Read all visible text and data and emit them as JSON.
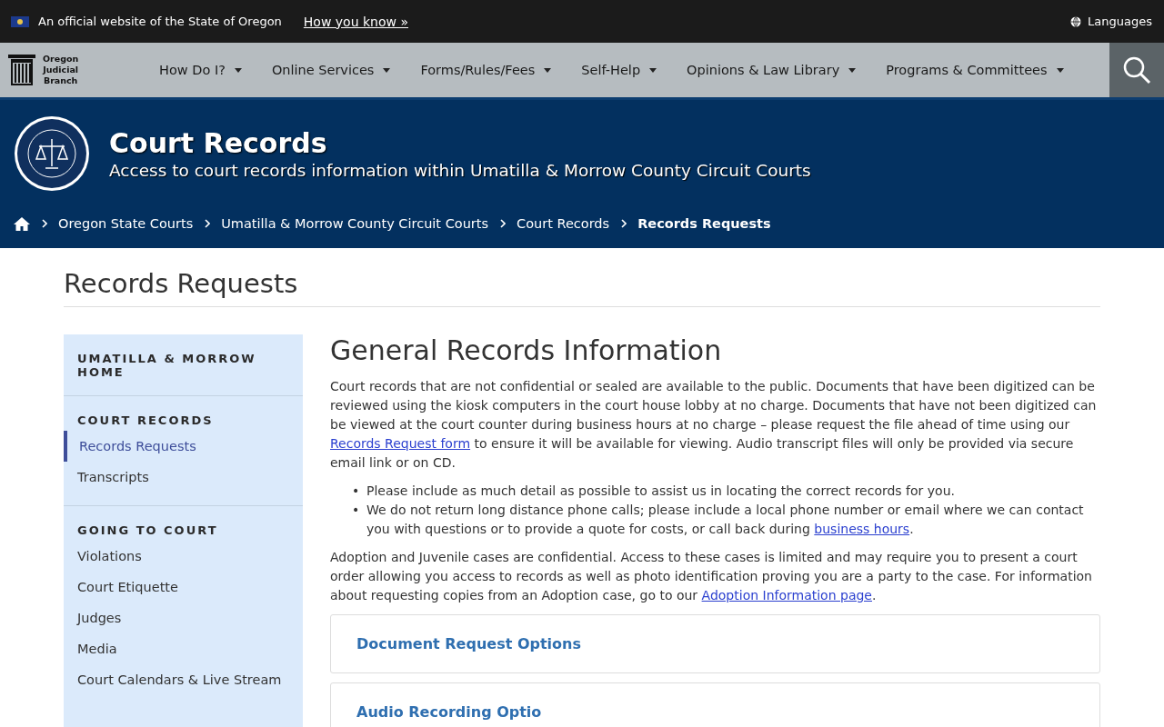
{
  "official_banner": {
    "text": "An official website of the State of Oregon",
    "link": "How you know »",
    "languages": "Languages"
  },
  "nav": {
    "logo": [
      "Oregon",
      "Judicial",
      "Branch"
    ],
    "items": [
      {
        "label": "How Do I?"
      },
      {
        "label": "Online Services"
      },
      {
        "label": "Forms/Rules/Fees"
      },
      {
        "label": "Self-Help"
      },
      {
        "label": "Opinions & Law Library"
      },
      {
        "label": "Programs & Committees"
      }
    ]
  },
  "hero": {
    "title": "Court Records",
    "subtitle": "Access to court records information within Umatilla & Morrow County Circuit Courts"
  },
  "breadcrumbs": [
    {
      "label": "Oregon State Courts",
      "current": false
    },
    {
      "label": "Umatilla & Morrow County Circuit Courts",
      "current": false
    },
    {
      "label": "Court Records",
      "current": false
    },
    {
      "label": "Records Requests",
      "current": true
    }
  ],
  "page_title": "Records Requests",
  "sidebar": {
    "sections": [
      {
        "heading": "UMATILLA & MORROW HOME"
      },
      {
        "heading": "COURT RECORDS",
        "items": [
          {
            "label": "Records Requests",
            "selected": true
          },
          {
            "label": "Transcripts",
            "selected": false
          }
        ]
      },
      {
        "heading": "GOING TO COURT",
        "items": [
          {
            "label": "Violations",
            "selected": false
          },
          {
            "label": "Court Etiquette",
            "selected": false
          },
          {
            "label": "Judges",
            "selected": false
          },
          {
            "label": "Media",
            "selected": false
          },
          {
            "label": "Court Calendars & Live Stream",
            "selected": false
          }
        ]
      }
    ]
  },
  "main": {
    "heading": "General Records Information",
    "blocks": [
      {
        "kind": "paragraph",
        "parts": [
          {
            "kind": "text",
            "text": "Court records that are not confidential or sealed are available to the public. Documents that have been digitized can be reviewed using the kiosk computers in the court house lobby at no charge. Documents that have not been digitized can be viewed at the court counter during business hours at no charge – please request the file ahead of time using our "
          },
          {
            "kind": "link",
            "text": "Records Request form"
          },
          {
            "kind": "text",
            "text": " to ensure it will be available for viewing. Audio transcript files will only be provided via secure email link or on CD."
          }
        ]
      },
      {
        "kind": "list",
        "items": [
          {
            "marker": "•",
            "parts": [
              {
                "kind": "text",
                "text": "Please include as much detail as possible to assist us in locating the correct records for you."
              }
            ]
          },
          {
            "marker": "•",
            "parts": [
              {
                "kind": "text",
                "text": "We do not return long distance phone calls; please include a local phone number or email where we can contact you with questions or to provide a quote for costs, or call back during "
              },
              {
                "kind": "link",
                "text": "business hours"
              },
              {
                "kind": "text",
                "text": "."
              }
            ]
          }
        ]
      },
      {
        "kind": "paragraph",
        "parts": [
          {
            "kind": "text",
            "text": "Adoption and Juvenile cases are confidential. Access to these cases is limited and may require you to present a court order allowing you access to records as well as photo identification proving you are a party to the case. For information about requesting copies from an Adoption case, go to our "
          },
          {
            "kind": "link",
            "text": "Adoption Information page"
          },
          {
            "kind": "text",
            "text": "."
          }
        ]
      }
    ],
    "accordions": [
      {
        "label": "Document Request Options",
        "expanded": false
      },
      {
        "label": "Audio Recording Optio",
        "expanded": false
      }
    ]
  }
}
